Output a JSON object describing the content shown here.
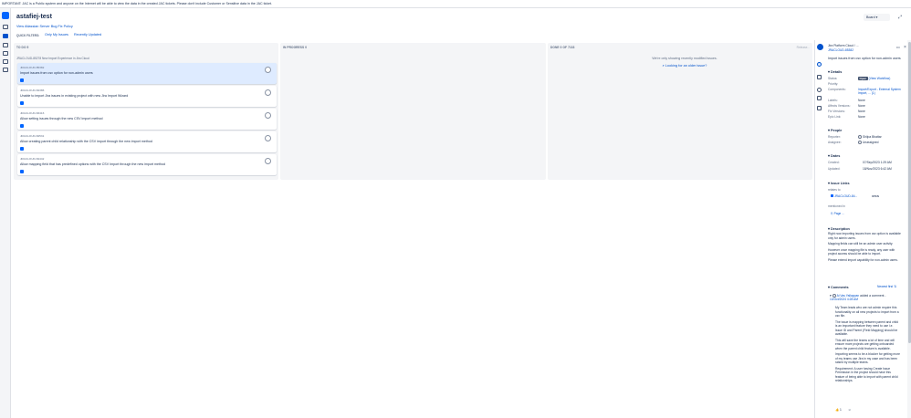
{
  "banner": "IMPORTANT: JAC is a Public system and anyone on the Internet will be able to view the data in the created JAC tickets. Please don't include Customer or Sensitive data in the JAC ticket.",
  "project": {
    "title": "astafiej-test",
    "policy_link": "View Atlassian Server Bug Fix Policy"
  },
  "quick_filters": {
    "label": "QUICK FILTERS:",
    "items": [
      "Only My Issues",
      "Recently Updated"
    ]
  },
  "header_buttons": {
    "board": "Board",
    "board_chevron": "▾",
    "expand": "⤢"
  },
  "columns": [
    {
      "title": "TO DO 5"
    },
    {
      "title": "IN PROGRESS 0"
    },
    {
      "title": "DONE 0 OF 7133",
      "release": "Release..."
    }
  ],
  "epic": "JRACLOUD-85278 New Import Experience in Jira Cloud",
  "cards": [
    {
      "key": "JRACLOUD-85382",
      "summary": "Import issues from csv option for non-admin users"
    },
    {
      "key": "JRACLOUD-84386",
      "summary": "Unable to import Jira issues in existing project with new Jira Import Wizard"
    },
    {
      "key": "JRACLOUD-83416",
      "summary": "Allow setting issues through the new CSV import method"
    },
    {
      "key": "JRACLOUD-84531",
      "summary": "Allow creating parent child relationship with the CSV import through the new import method"
    },
    {
      "key": "JRACLOUD-84442",
      "summary": "Allow mapping field that has predefined options with the CSV Import through the new import method"
    }
  ],
  "done_note": "We're only showing recently modified issues.",
  "done_link": "Looking for an older issue?",
  "panel": {
    "project_name": "Jira Platform Cloud / ...",
    "issue_key": "JRACLOUD-85382",
    "more": "•••",
    "close": "×",
    "summary": "Import issues from csv option for non-admin users",
    "details_title": "Details",
    "details": [
      {
        "label": "Status:",
        "value": "Open",
        "extra": "(View Workflow)"
      },
      {
        "label": "Priority:",
        "value": ""
      },
      {
        "label": "Components:",
        "value": "Import/Export - External System Import, ... (1)"
      },
      {
        "label": "Labels:",
        "value": "None"
      },
      {
        "label": "Affects Versions:",
        "value": "None"
      },
      {
        "label": "Fix Versions:",
        "value": "None"
      },
      {
        "label": "Epic Link:",
        "value": "None"
      }
    ],
    "people_title": "People",
    "reporter_label": "Reporter:",
    "reporter": "Shilpa Bhattar",
    "assignee_label": "Assignee:",
    "assignee": "Unassigned",
    "dates_title": "Dates",
    "created_label": "Created:",
    "created": "07/Sep/2023 1:29 AM",
    "updated_label": "Updated:",
    "updated": "18/Nov/2023 6:42 AM",
    "links_title": "Issue Links",
    "relates_to": "relates to",
    "linked_key": "JRACLOUD-84...",
    "linked_status": "OPEN",
    "mentioned_in": "mentioned in",
    "page_link": "Page ...",
    "description_title": "Description",
    "description": [
      "Right now importing issues from csv option is available only for admin users.",
      "Mapping fields can still be an admin user activity.",
      "However once mapping file is ready, any user with project access should be able to import.",
      "Please extend import capability for non-admin users."
    ],
    "comments_title": "Comments",
    "newest_first": "Newest first ⇅",
    "comment_author": "Ai Vas Yallappan",
    "comment_meta": "added a comment -",
    "comment_date": "10/Oct/2024 4:28 AM",
    "comment": [
      "My Team leads who are not admin require this functionality on all new projects to import from a csv file.",
      "The issue is mapping between parent and child is an important feature they need to use i.e. Issue ID and Parent (Field Mapping) should be available.",
      "This will save the teams a lot of time and will ensure more projects are getting onboarded when the parent child feature is available.",
      "Importing seems to be a blocker for getting more of my teams use Jira in my case and has been raised by multiple teams.",
      "Requirement: A user having Create Issue Permission in the project should have this feature of being able to import with parent child relationships."
    ],
    "likes": "👍 1"
  }
}
